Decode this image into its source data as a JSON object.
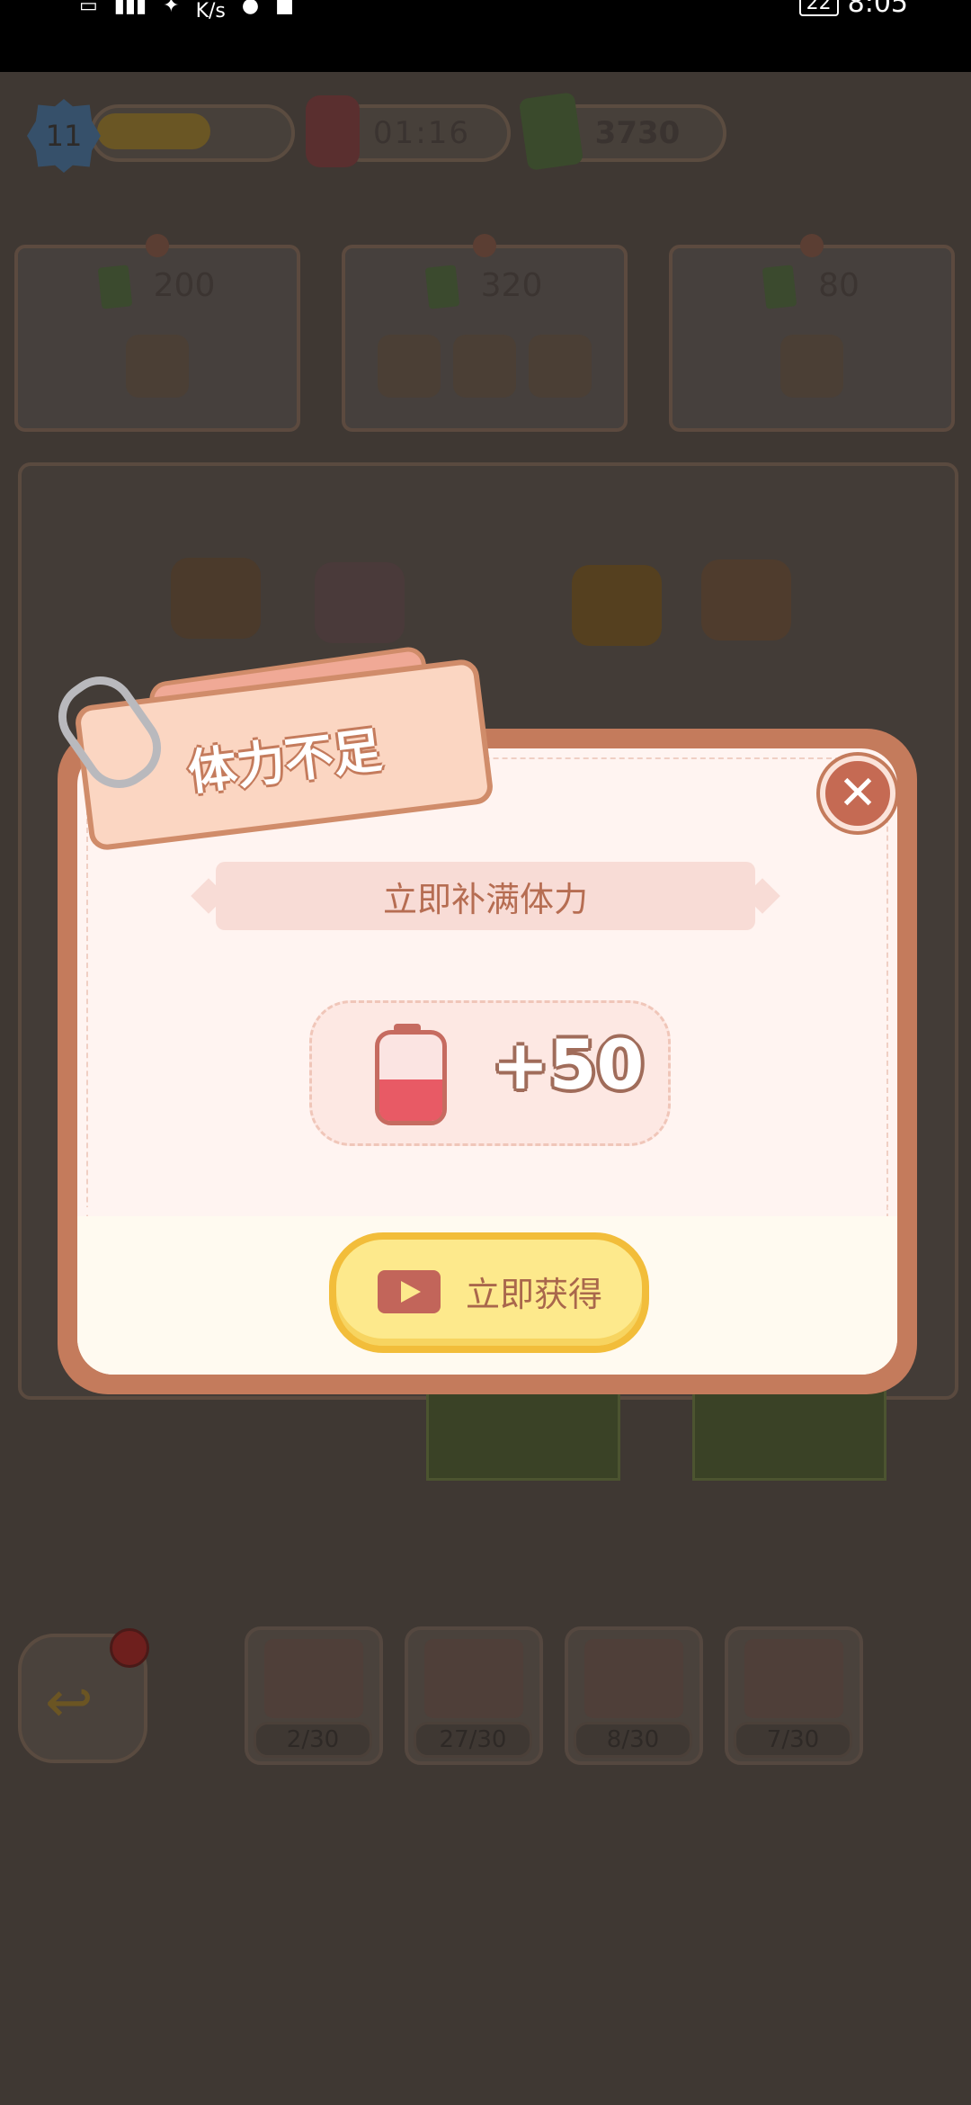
{
  "status_bar": {
    "net_speed": "K/s",
    "battery": "22",
    "time": "8:05"
  },
  "hud": {
    "level": "11",
    "level_progress": 0.62,
    "energy_timer": "01:16",
    "coins": "3730"
  },
  "orders": [
    {
      "price": "200",
      "items": [
        "bear-plush"
      ]
    },
    {
      "price": "320",
      "items": [
        "brown-bag",
        "white-shirt",
        "snack-pack"
      ]
    },
    {
      "price": "80",
      "items": [
        "safety-pin"
      ]
    }
  ],
  "collections": [
    {
      "name": "wardrobe",
      "count": "2/30"
    },
    {
      "name": "snacks",
      "count": "27/30"
    },
    {
      "name": "phone",
      "count": "8/30"
    },
    {
      "name": "toy-box",
      "count": "7/30"
    }
  ],
  "dialog": {
    "title": "体力不足",
    "subtitle": "立即补满体力",
    "reward_amount": "+50",
    "action_label": "立即获得"
  },
  "colors": {
    "accent_peach": "#c47b5c",
    "button_yellow": "#fde98c",
    "close_red": "#c56a53"
  }
}
